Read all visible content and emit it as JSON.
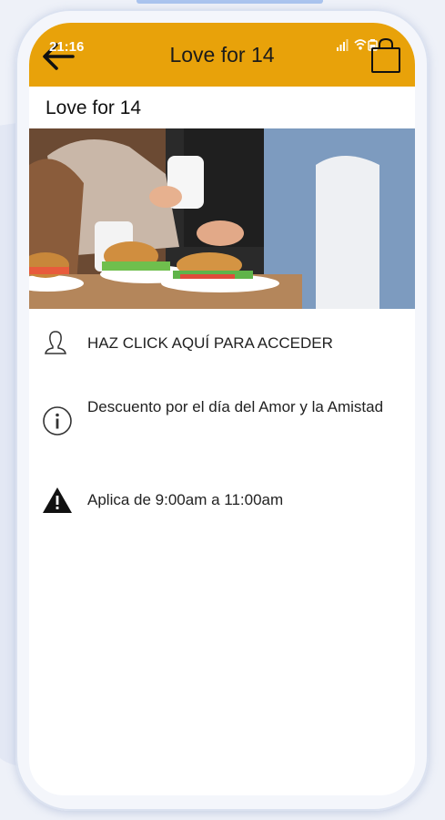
{
  "status_bar": {
    "time": "21:16"
  },
  "app_bar": {
    "title": "Love for 14"
  },
  "page": {
    "subtitle": "Love for 14"
  },
  "hero_image": {
    "description": "couple-breakfast-photo"
  },
  "info_rows": [
    {
      "icon": "user-icon",
      "text": "HAZ CLICK AQUÍ PARA ACCEDER"
    },
    {
      "icon": "info-icon",
      "text": "Descuento por el día del Amor y la Amistad"
    },
    {
      "icon": "warning-icon",
      "text": "Aplica de 9:00am a 11:00am"
    }
  ],
  "colors": {
    "accent": "#E8A20A",
    "background": "#FFFFFF"
  }
}
